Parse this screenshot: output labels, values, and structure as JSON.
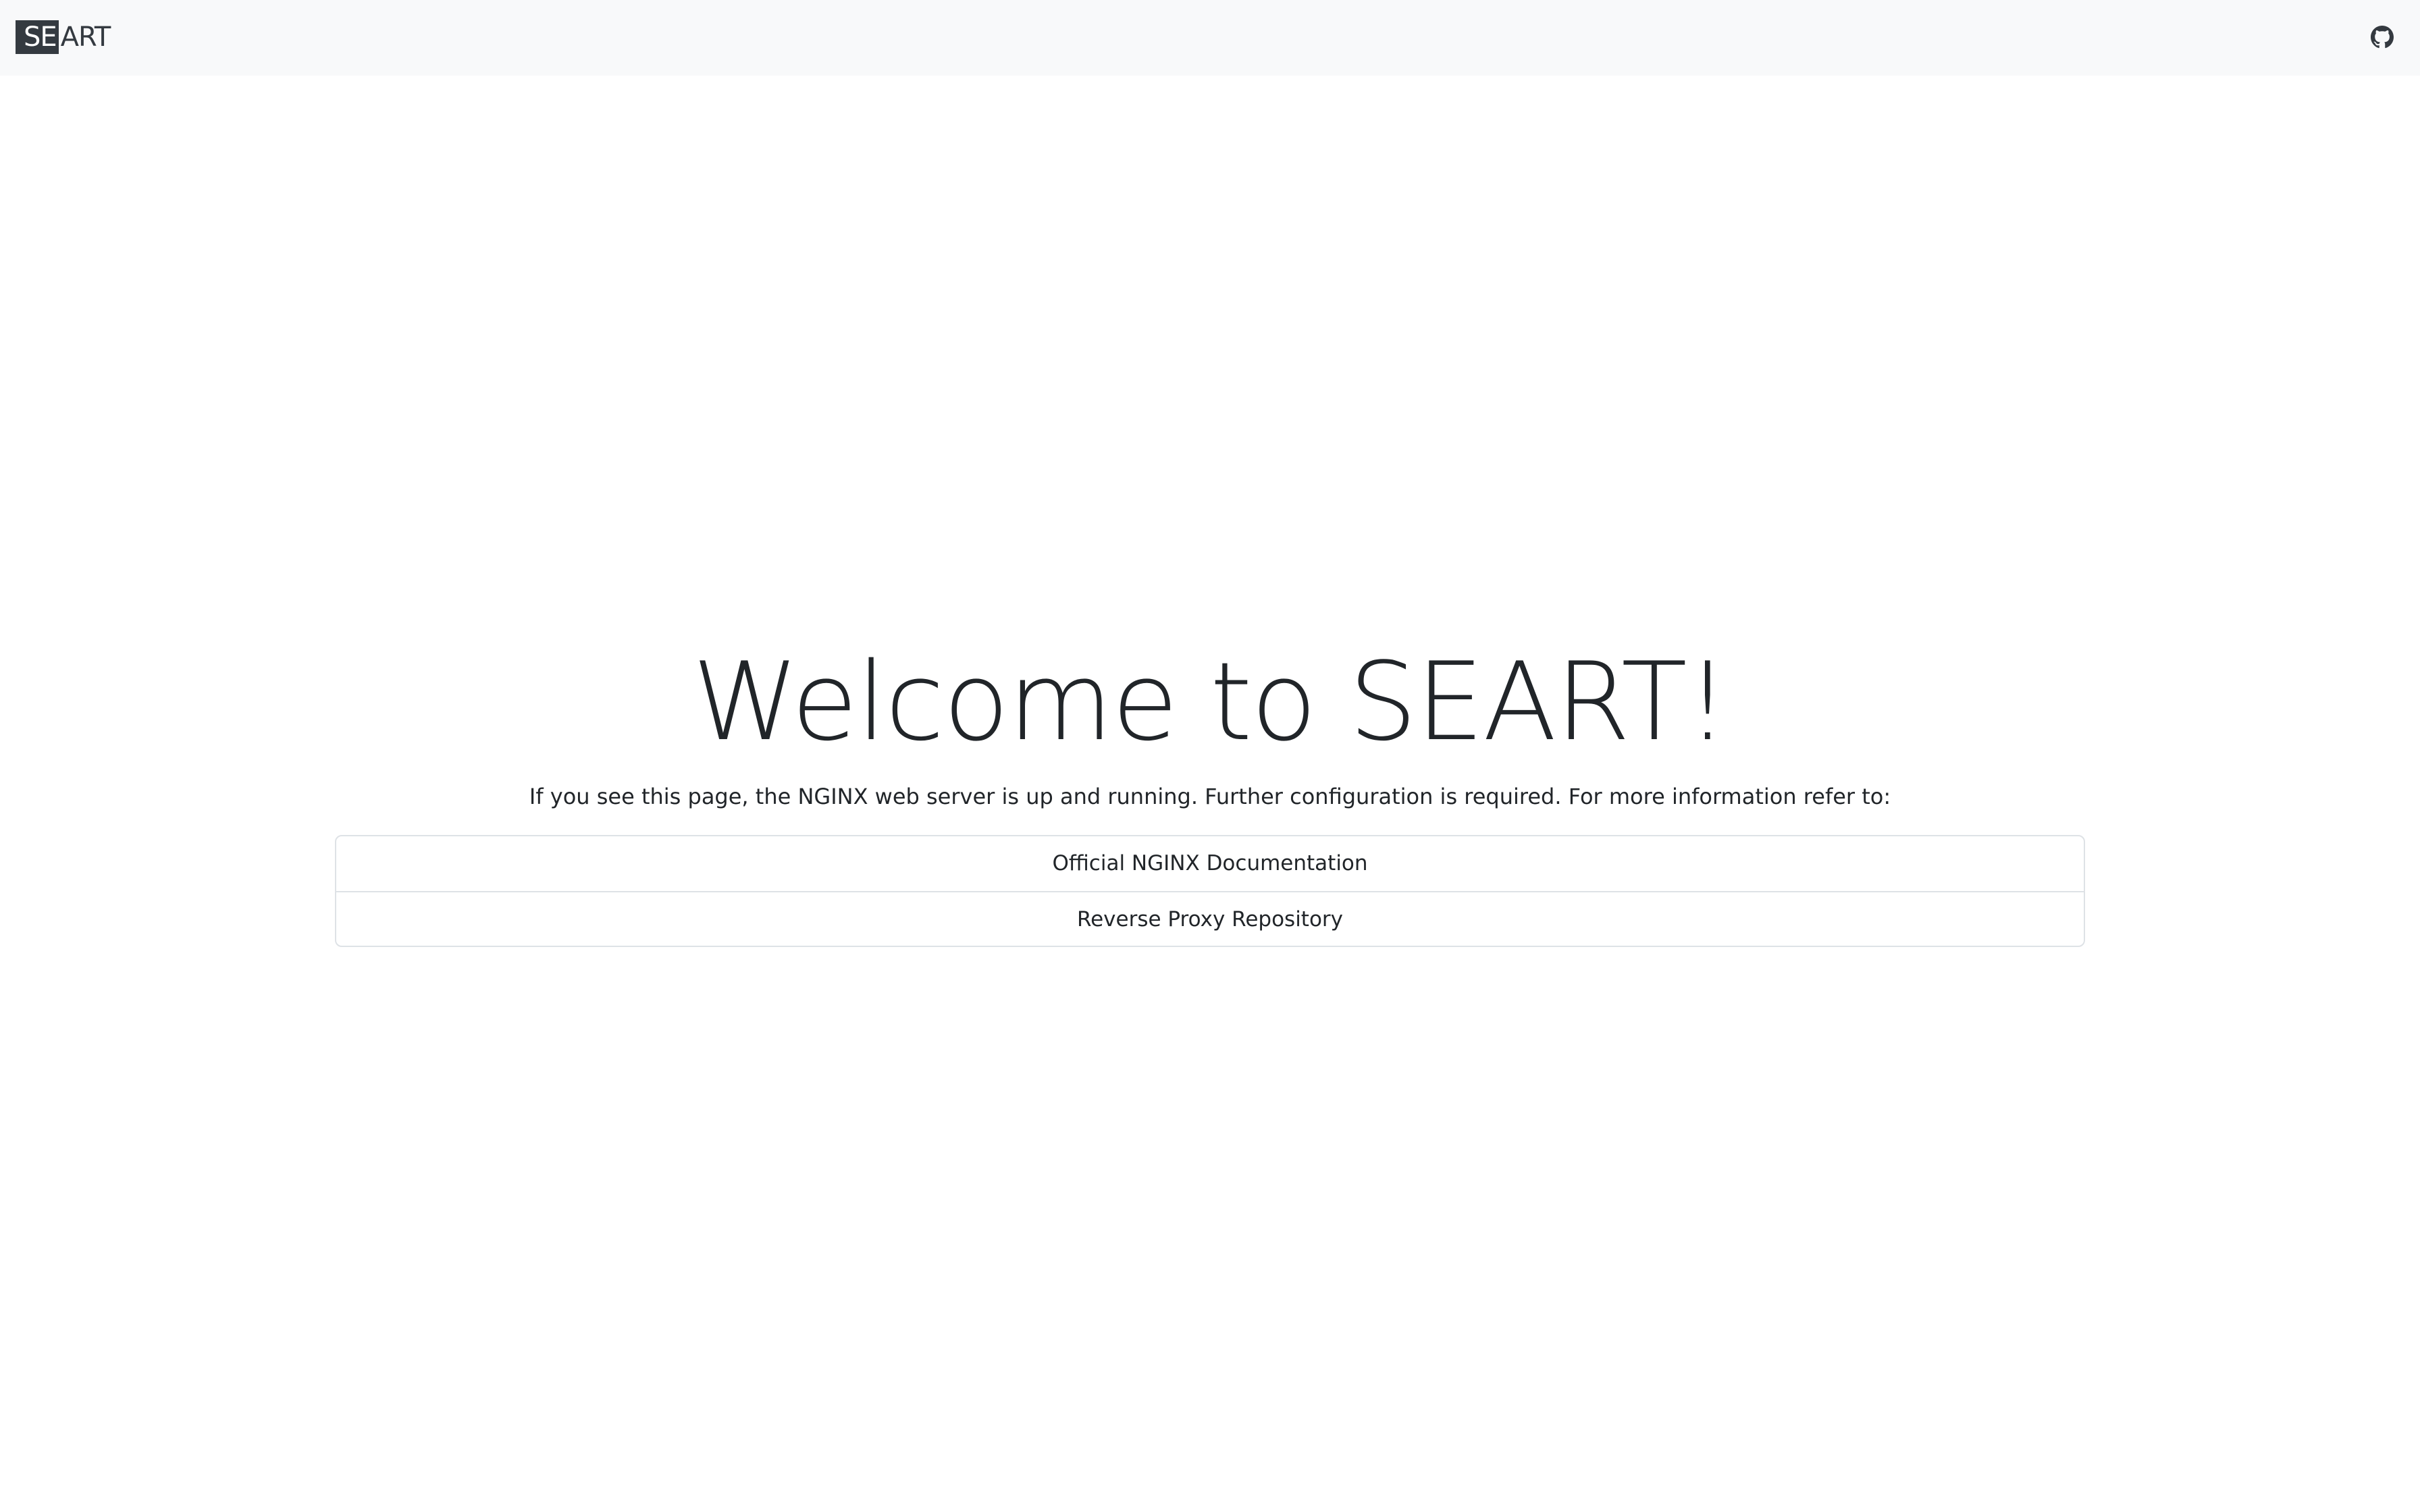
{
  "navbar": {
    "brand_highlight": "SE",
    "brand_rest": "ART",
    "github_icon": "github-icon"
  },
  "main": {
    "title": "Welcome to SEART!",
    "lead": "If you see this page, the NGINX web server is up and running. Further configuration is required. For more information refer to:",
    "links": [
      {
        "label": "Official NGINX Documentation"
      },
      {
        "label": "Reverse Proxy Repository"
      }
    ]
  },
  "colors": {
    "navbar_bg": "#f8f9fa",
    "brand_dark": "#343a40",
    "text": "#212529",
    "border": "#dee2e6"
  }
}
